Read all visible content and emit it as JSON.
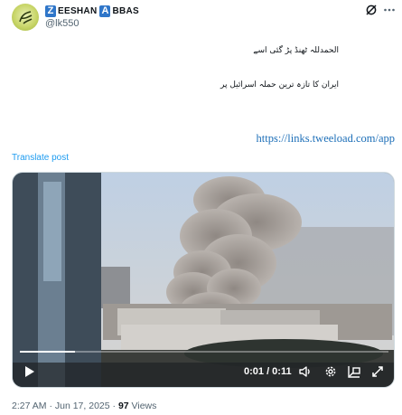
{
  "author": {
    "name_letter_1": "Z",
    "name_part_1": "EESHAN",
    "name_letter_2": "A",
    "name_part_2": "BBAS",
    "handle": "@lk550"
  },
  "post": {
    "line_1": "الحمدللہ ٹھنڈ پڑ گئی اسے",
    "line_2": "ایران کا تازہ ترین حملہ اسرائیل پر",
    "link": "https://links.tweeload.com/app",
    "translate": "Translate post"
  },
  "video": {
    "time": "0:01 / 0:11",
    "progress": 0.15
  },
  "footer": {
    "time": "2:27 AM",
    "date": "Jun 17, 2025",
    "views_count": "97",
    "views_label": "Views",
    "separator": "·"
  },
  "icons": {
    "grok": "grok-icon",
    "more": "more-icon",
    "play": "play-icon",
    "volume": "volume-icon",
    "settings": "gear-icon",
    "pip": "picture-in-picture-icon",
    "fullscreen": "fullscreen-icon"
  }
}
